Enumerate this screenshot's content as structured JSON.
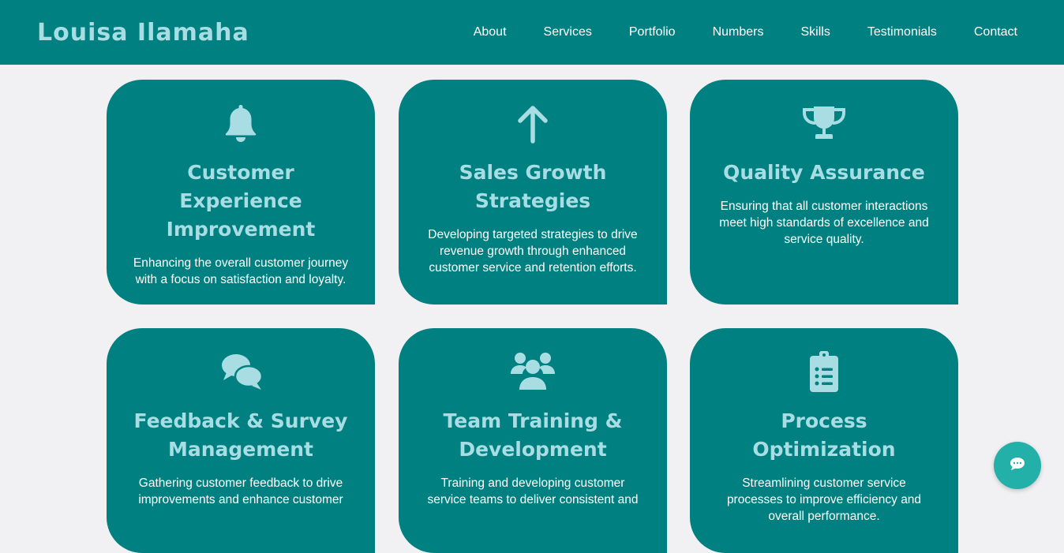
{
  "header": {
    "brand": "Louisa Ilamaha",
    "nav": [
      "About",
      "Services",
      "Portfolio",
      "Numbers",
      "Skills",
      "Testimonials",
      "Contact"
    ]
  },
  "services": [
    {
      "icon": "bell-icon",
      "title": "Customer Experience Improvement",
      "description": "Enhancing the overall customer journey with a focus on satisfaction and loyalty."
    },
    {
      "icon": "arrow-up-icon",
      "title": "Sales Growth Strategies",
      "description": "Developing targeted strategies to drive revenue growth through enhanced customer service and retention efforts."
    },
    {
      "icon": "trophy-icon",
      "title": "Quality Assurance",
      "description": "Ensuring that all customer interactions meet high standards of excellence and service quality."
    },
    {
      "icon": "comments-icon",
      "title": "Feedback & Survey Management",
      "description": "Gathering customer feedback to drive improvements and enhance customer"
    },
    {
      "icon": "users-icon",
      "title": "Team Training & Development",
      "description": "Training and developing customer service teams to deliver consistent and"
    },
    {
      "icon": "clipboard-list-icon",
      "title": "Process Optimization",
      "description": "Streamlining customer service processes to improve efficiency and overall performance."
    }
  ],
  "colors": {
    "primary": "#008080",
    "accent": "#a8dde4",
    "background": "#f1f1f3",
    "chat_button": "#23b0a8"
  },
  "chat": {
    "icon": "chat-bubble-icon"
  }
}
